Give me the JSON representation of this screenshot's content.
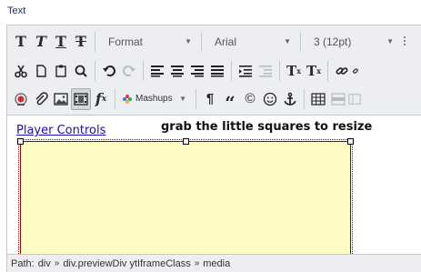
{
  "field_label": "Text",
  "toolbar": {
    "row1": {
      "bold": "T",
      "italic": "T",
      "underline": "T",
      "strikethrough": "T",
      "format": "Format",
      "font": "Arial",
      "size": "3 (12pt)"
    },
    "row2": {
      "superscript": "T",
      "superscript_mark": "x",
      "subscript": "T",
      "subscript_mark": "x"
    },
    "row3": {
      "function": "f",
      "function_sub": "x",
      "mashups": "Mashups",
      "pilcrow": "¶",
      "quote": "“",
      "copyright": "©"
    }
  },
  "content": {
    "link_text": "Player Controls",
    "note": "grab the little squares to resize"
  },
  "status": {
    "label": "Path:",
    "crumbs": [
      "div",
      "div.previewDiv ytIframeClass",
      "media"
    ]
  },
  "colors": {
    "media_fill": "#fffbc4",
    "media_border": "#7a1010",
    "toolbar_bg": "#eceef1",
    "link": "#1a0dab"
  }
}
